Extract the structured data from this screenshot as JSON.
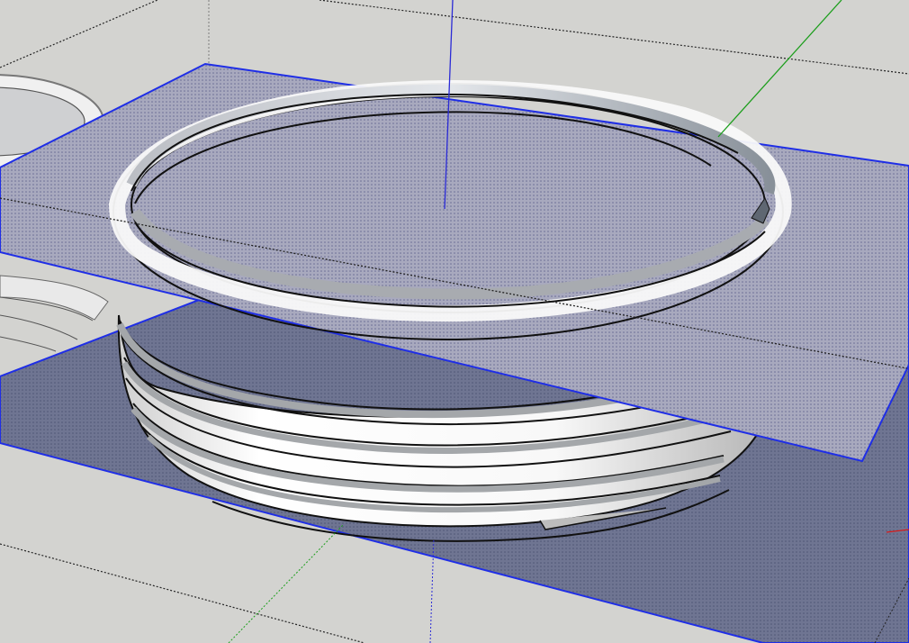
{
  "app": {
    "name": "",
    "view_type": "3d-model-viewport"
  },
  "scene": {
    "description_tags": [
      "threaded-ring-model",
      "section-planes",
      "axes"
    ],
    "colors": {
      "background": "#d3d3d0",
      "section_plane_fill": "#8e91b3",
      "section_plane_edge": "#1f2ee6",
      "axis_blue": "#2b2bd6",
      "axis_green": "#1c9e1c",
      "axis_red": "#d61c1c",
      "model_face": "#f4f4f4",
      "model_shadow": "#9fa1a3",
      "model_edge": "#111111"
    },
    "icons": [
      "section-plane-upper",
      "section-plane-lower",
      "blue-axis-icon",
      "green-axis-icon",
      "red-axis-icon"
    ]
  }
}
